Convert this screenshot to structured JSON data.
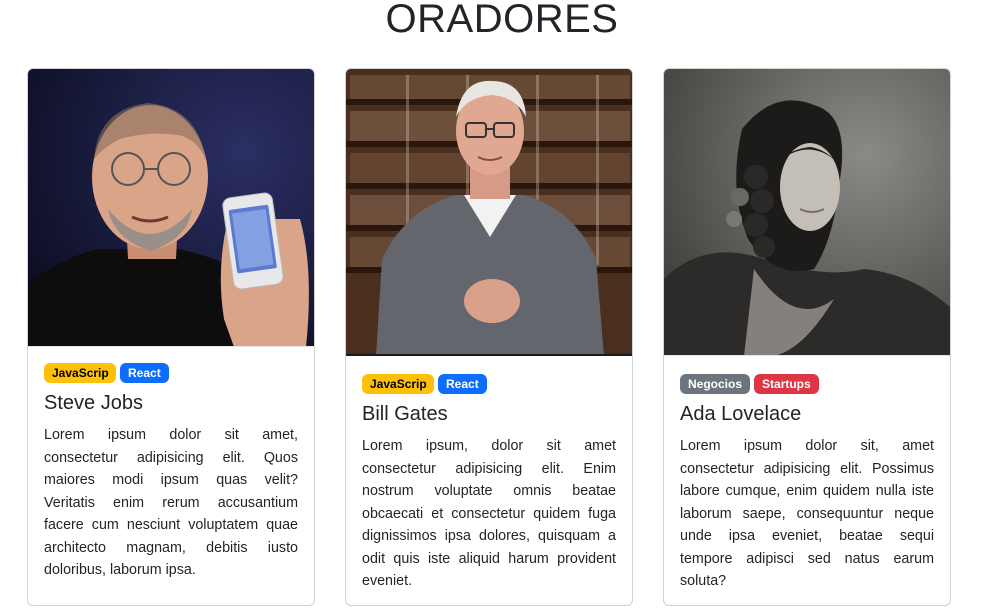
{
  "page": {
    "title": "ORADORES"
  },
  "speakers": [
    {
      "name": "Steve Jobs",
      "tags": [
        {
          "label": "JavaScrip",
          "bg": "#ffc107",
          "fg": "#000000"
        },
        {
          "label": "React",
          "bg": "#0d6efd",
          "fg": "#ffffff"
        }
      ],
      "bio": "Lorem ipsum dolor sit amet, consectetur adipisicing elit. Quos maiores modi ipsum quas velit? Veritatis enim rerum accusantium facere cum nesciunt voluptatem quae architecto magnam, debitis iusto doloribus, laborum ipsa.",
      "photo_icon": "portrait-photo"
    },
    {
      "name": "Bill Gates",
      "tags": [
        {
          "label": "JavaScrip",
          "bg": "#ffc107",
          "fg": "#000000"
        },
        {
          "label": "React",
          "bg": "#0d6efd",
          "fg": "#ffffff"
        }
      ],
      "bio": "Lorem ipsum, dolor sit amet consectetur adipisicing elit. Enim nostrum voluptate omnis beatae obcaecati et consectetur quidem fuga dignissimos ipsa dolores, quisquam a odit quis iste aliquid harum provident eveniet.",
      "photo_icon": "portrait-photo"
    },
    {
      "name": "Ada Lovelace",
      "tags": [
        {
          "label": "Negocios",
          "bg": "#6c757d",
          "fg": "#ffffff"
        },
        {
          "label": "Startups",
          "bg": "#dc3545",
          "fg": "#ffffff"
        }
      ],
      "bio": "Lorem ipsum dolor sit, amet consectetur adipisicing elit. Possimus labore cumque, enim quidem nulla iste laborum saepe, consequuntur neque unde ipsa eveniet, beatae sequi tempore adipisci sed natus earum soluta?",
      "photo_icon": "portrait-photo"
    }
  ]
}
